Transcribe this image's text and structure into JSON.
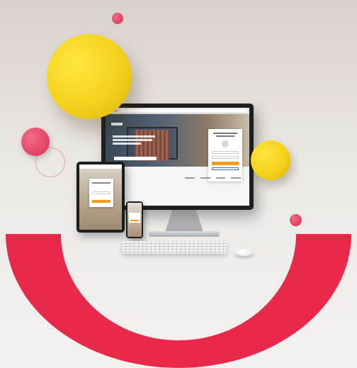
{
  "scene": {
    "description_label": "",
    "colors": {
      "accent_red": "#e8294c",
      "accent_yellow": "#f4d21c",
      "button_orange": "#f29a1a"
    }
  },
  "icons": {
    "monitor": "desktop-monitor-icon",
    "tablet": "tablet-icon",
    "phone": "smartphone-icon",
    "keyboard": "keyboard-icon",
    "mouse": "mouse-icon"
  }
}
